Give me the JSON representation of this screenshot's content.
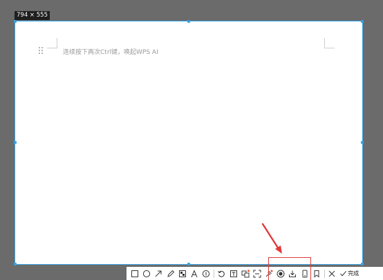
{
  "size_label": "794 × 555",
  "doc": {
    "hint": "连续按下两次Ctrl键，唤起WPS AI"
  },
  "toolbar": {
    "tools": [
      {
        "name": "rectangle-icon"
      },
      {
        "name": "ellipse-icon"
      },
      {
        "name": "arrow-icon"
      },
      {
        "name": "pen-icon"
      },
      {
        "name": "mosaic-icon"
      },
      {
        "name": "text-icon"
      },
      {
        "name": "number-marker-icon"
      },
      {
        "name": "undo-icon"
      },
      {
        "name": "ocr-icon"
      },
      {
        "name": "translate-icon"
      },
      {
        "name": "scan-icon"
      },
      {
        "name": "pin-icon"
      },
      {
        "name": "record-icon"
      },
      {
        "name": "download-icon"
      },
      {
        "name": "phone-icon"
      },
      {
        "name": "bookmark-icon"
      },
      {
        "name": "close-icon"
      }
    ],
    "done_label": "完成"
  },
  "colors": {
    "accent": "#36a3e6",
    "highlight": "#e03a3a",
    "backdrop": "#6b6b6b"
  }
}
